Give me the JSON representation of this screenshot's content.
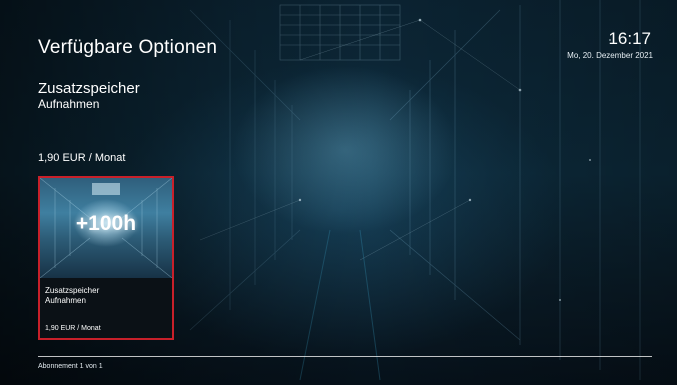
{
  "header": {
    "title": "Verfügbare Optionen",
    "time": "16:17",
    "date": "Mo, 20. Dezember 2021"
  },
  "selected_option": {
    "title": "Zusatzspeicher",
    "subtitle": "Aufnahmen",
    "price": "1,90 EUR / Monat"
  },
  "tiles": [
    {
      "badge": "+100h",
      "name_line1": "Zusatzspeicher",
      "name_line2": "Aufnahmen",
      "price": "1,90 EUR / Monat",
      "selected": true
    }
  ],
  "footer": {
    "status": "Abonnement 1 von 1"
  },
  "colors": {
    "focus_border": "#c8202a",
    "background": "#0a1a26"
  }
}
